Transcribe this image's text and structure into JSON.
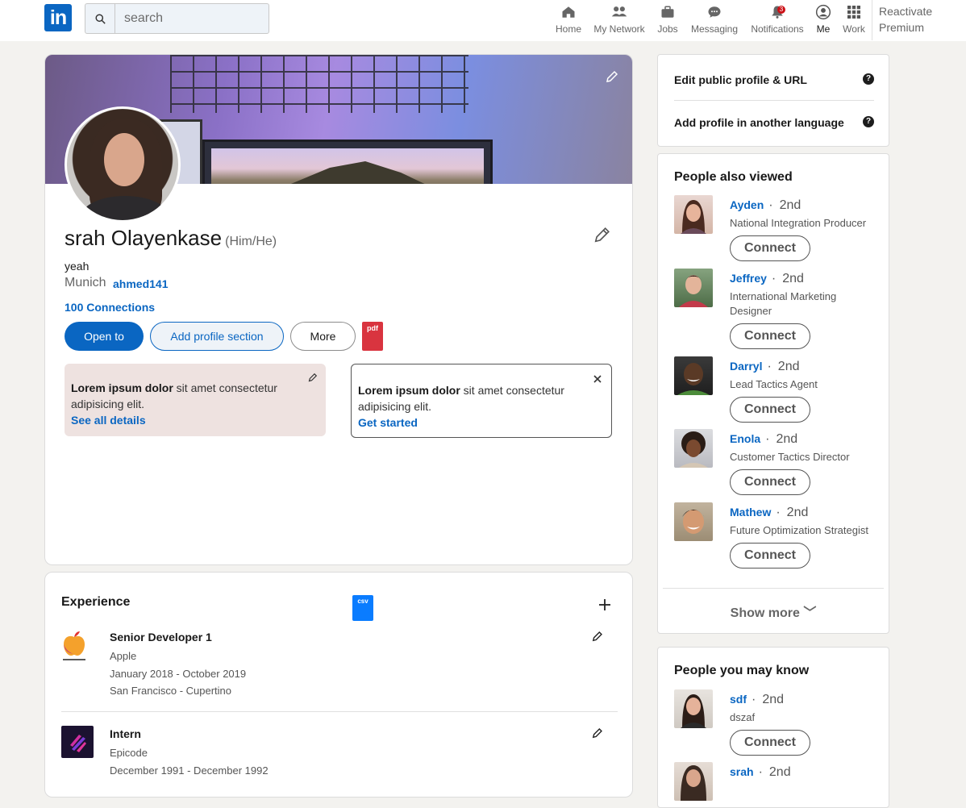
{
  "nav": {
    "logo": "in",
    "search_placeholder": "search",
    "items": [
      {
        "label": "Home",
        "icon": "home-icon"
      },
      {
        "label": "My Network",
        "icon": "network-icon"
      },
      {
        "label": "Jobs",
        "icon": "briefcase-icon"
      },
      {
        "label": "Messaging",
        "icon": "messaging-icon"
      },
      {
        "label": "Notifications",
        "icon": "bell-icon",
        "badge": "3"
      },
      {
        "label": "Me",
        "icon": "user-icon"
      },
      {
        "label": "Work",
        "icon": "grid-icon"
      }
    ],
    "premium_line1": "Reactivate",
    "premium_line2": "Premium"
  },
  "profile": {
    "name": "srah Olayenkase",
    "pronouns": "(Him/He)",
    "headline": "yeah",
    "location": "Munich",
    "handle": "ahmed141",
    "connections": "100 Connections",
    "buttons": {
      "open_to": "Open to",
      "add_section": "Add profile section",
      "more": "More"
    },
    "pdf_label": "pdf",
    "cards": [
      {
        "bold": "Lorem ipsum dolor",
        "text": " sit amet consectetur adipisicing elit.",
        "link": "See all details"
      },
      {
        "bold": "Lorem ipsum dolor",
        "text": " sit amet consectetur adipisicing elit.",
        "link": "Get started"
      }
    ]
  },
  "experience": {
    "title": "Experience",
    "csv_label": "csv",
    "items": [
      {
        "role": "Senior Developer 1",
        "company": "Apple",
        "dates": "January 2018 - October 2019",
        "location": "San Francisco - Cupertino"
      },
      {
        "role": "Intern",
        "company": "Epicode",
        "dates": "December 1991 - December 1992"
      }
    ]
  },
  "rail": {
    "links": [
      "Edit public profile & URL",
      "Add profile in another language"
    ],
    "also_viewed_title": "People also viewed",
    "people": [
      {
        "name": "Ayden",
        "degree": "2nd",
        "title": "National Integration Producer"
      },
      {
        "name": "Jeffrey",
        "degree": "2nd",
        "title": "International Marketing Designer"
      },
      {
        "name": "Darryl",
        "degree": "2nd",
        "title": "Lead Tactics Agent"
      },
      {
        "name": "Enola",
        "degree": "2nd",
        "title": "Customer Tactics Director"
      },
      {
        "name": "Mathew",
        "degree": "2nd",
        "title": "Future Optimization Strategist"
      }
    ],
    "connect_label": "Connect",
    "show_more": "Show more ﹀",
    "may_know_title": "People you may know",
    "may_know": [
      {
        "name": "sdf",
        "degree": "2nd",
        "title": "dszaf"
      },
      {
        "name": "srah",
        "degree": "2nd",
        "title": ""
      }
    ]
  }
}
